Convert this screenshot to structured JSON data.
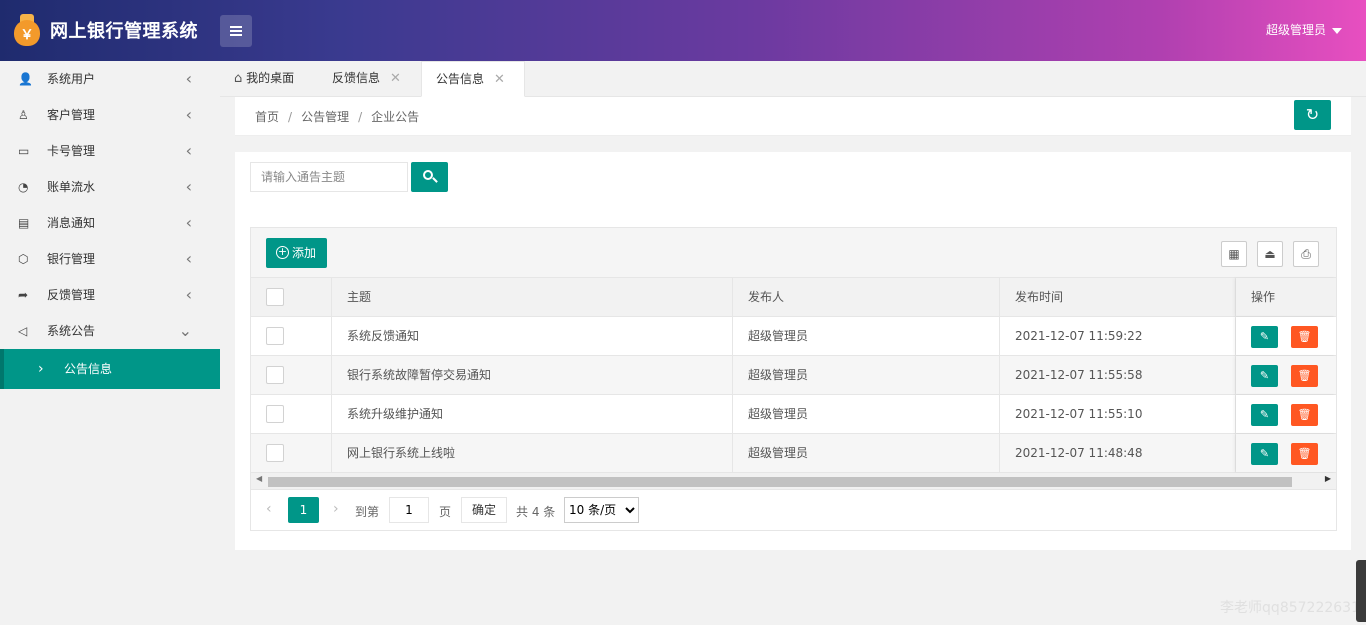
{
  "header": {
    "app_title": "网上银行管理系统",
    "logo_glyph": "￥",
    "user_name": "超级管理员"
  },
  "sidebar": {
    "items": [
      {
        "label": "系统用户",
        "icon": "user-icon"
      },
      {
        "label": "客户管理",
        "icon": "person-icon"
      },
      {
        "label": "卡号管理",
        "icon": "id-card-icon"
      },
      {
        "label": "账单流水",
        "icon": "chart-icon"
      },
      {
        "label": "消息通知",
        "icon": "message-icon"
      },
      {
        "label": "银行管理",
        "icon": "cube-icon"
      },
      {
        "label": "反馈管理",
        "icon": "share-icon"
      },
      {
        "label": "系统公告",
        "icon": "speaker-icon"
      }
    ],
    "sub_item": "公告信息"
  },
  "tabs": [
    {
      "label": "我的桌面",
      "closable": false
    },
    {
      "label": "反馈信息",
      "closable": true
    },
    {
      "label": "公告信息",
      "closable": true,
      "active": true
    }
  ],
  "breadcrumb": {
    "home": "首页",
    "section": "公告管理",
    "current": "企业公告",
    "separator": "/"
  },
  "search": {
    "placeholder": "请输入通告主题"
  },
  "toolbar": {
    "add_label": "添加"
  },
  "table": {
    "columns": [
      "主题",
      "发布人",
      "发布时间",
      "操作"
    ],
    "rows": [
      {
        "title": "系统反馈通知",
        "publisher": "超级管理员",
        "time": "2021-12-07 11:59:22"
      },
      {
        "title": "银行系统故障暂停交易通知",
        "publisher": "超级管理员",
        "time": "2021-12-07 11:55:58"
      },
      {
        "title": "系统升级维护通知",
        "publisher": "超级管理员",
        "time": "2021-12-07 11:55:10"
      },
      {
        "title": "网上银行系统上线啦",
        "publisher": "超级管理员",
        "time": "2021-12-07 11:48:48"
      }
    ]
  },
  "pager": {
    "current_page": "1",
    "goto_label": "到第",
    "goto_value": "1",
    "page_unit": "页",
    "confirm_label": "确定",
    "total_label": "共 4 条",
    "page_size": "10 条/页",
    "page_size_options": [
      "10 条/页"
    ]
  },
  "watermark": "李老师qq857222631",
  "colors": {
    "accent": "#009688",
    "danger": "#ff5722",
    "header_start": "#1f2b6e",
    "header_end": "#e84fc0"
  }
}
